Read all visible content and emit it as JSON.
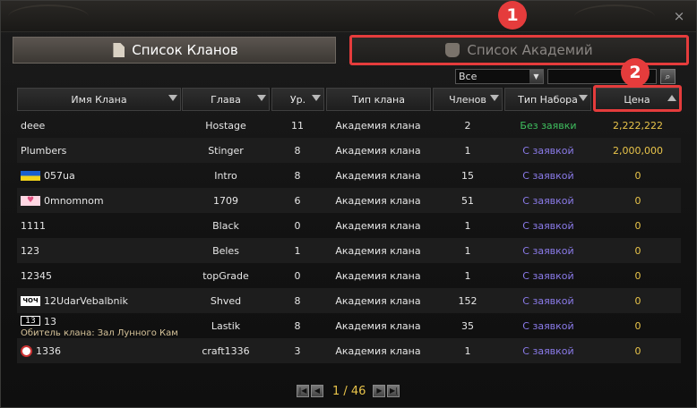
{
  "window": {
    "close_icon": "×"
  },
  "tabs": {
    "clan_list": "Список Кланов",
    "academy_list": "Список Академий"
  },
  "callouts": {
    "badge_1": "1",
    "badge_2": "2",
    "color": "#e53c3c"
  },
  "filter": {
    "select_value": "Все",
    "dropdown_icon": "▼",
    "search_placeholder": "",
    "search_icon": "⌕"
  },
  "table": {
    "headers": {
      "name": "Имя Клана",
      "leader": "Глава",
      "level": "Ур.",
      "clan_type": "Тип клана",
      "members": "Членов",
      "recruit_type": "Тип Набора",
      "price": "Цена"
    },
    "rows": [
      {
        "name": "deee",
        "leader": "Hostage",
        "level": "11",
        "type": "Академия клана",
        "members": "2",
        "recruit": "Без заявки",
        "price": "2,222,222",
        "emblem": "none"
      },
      {
        "name": "Plumbers",
        "leader": "Stinger",
        "level": "8",
        "type": "Академия клана",
        "members": "1",
        "recruit": "С заявкой",
        "price": "2,000,000",
        "emblem": "none"
      },
      {
        "name": "057ua",
        "leader": "Intro",
        "level": "8",
        "type": "Академия клана",
        "members": "15",
        "recruit": "С заявкой",
        "price": "0",
        "emblem": "ukraine-flag"
      },
      {
        "name": "0mnomnom",
        "leader": "1709",
        "level": "6",
        "type": "Академия клана",
        "members": "51",
        "recruit": "С заявкой",
        "price": "0",
        "emblem": "heart"
      },
      {
        "name": "1111",
        "leader": "Black",
        "level": "0",
        "type": "Академия клана",
        "members": "1",
        "recruit": "С заявкой",
        "price": "0",
        "emblem": "none"
      },
      {
        "name": "123",
        "leader": "Beles",
        "level": "1",
        "type": "Академия клана",
        "members": "1",
        "recruit": "С заявкой",
        "price": "0",
        "emblem": "none"
      },
      {
        "name": "12345",
        "leader": "topGrade",
        "level": "0",
        "type": "Академия клана",
        "members": "1",
        "recruit": "С заявкой",
        "price": "0",
        "emblem": "none"
      },
      {
        "name": "12UdarVebalbnik",
        "leader": "Shved",
        "level": "8",
        "type": "Академия клана",
        "members": "152",
        "recruit": "С заявкой",
        "price": "0",
        "emblem": "bw-text",
        "emblem_text": "ЧОЧ"
      },
      {
        "name": "13",
        "leader": "Lastik",
        "level": "8",
        "type": "Академия клана",
        "members": "35",
        "recruit": "С заявкой",
        "price": "0",
        "emblem": "number-13",
        "emblem_text": "13",
        "subtext": "Обитель клана: Зал Лунного Кам"
      },
      {
        "name": "1336",
        "leader": "craft1336",
        "level": "3",
        "type": "Академия клана",
        "members": "1",
        "recruit": "С заявкой",
        "price": "0",
        "emblem": "circle"
      }
    ]
  },
  "pager": {
    "first_icon": "|◀",
    "prev_icon": "◀",
    "pages": "1 / 46",
    "next_icon": "▶",
    "last_icon": "▶|"
  }
}
